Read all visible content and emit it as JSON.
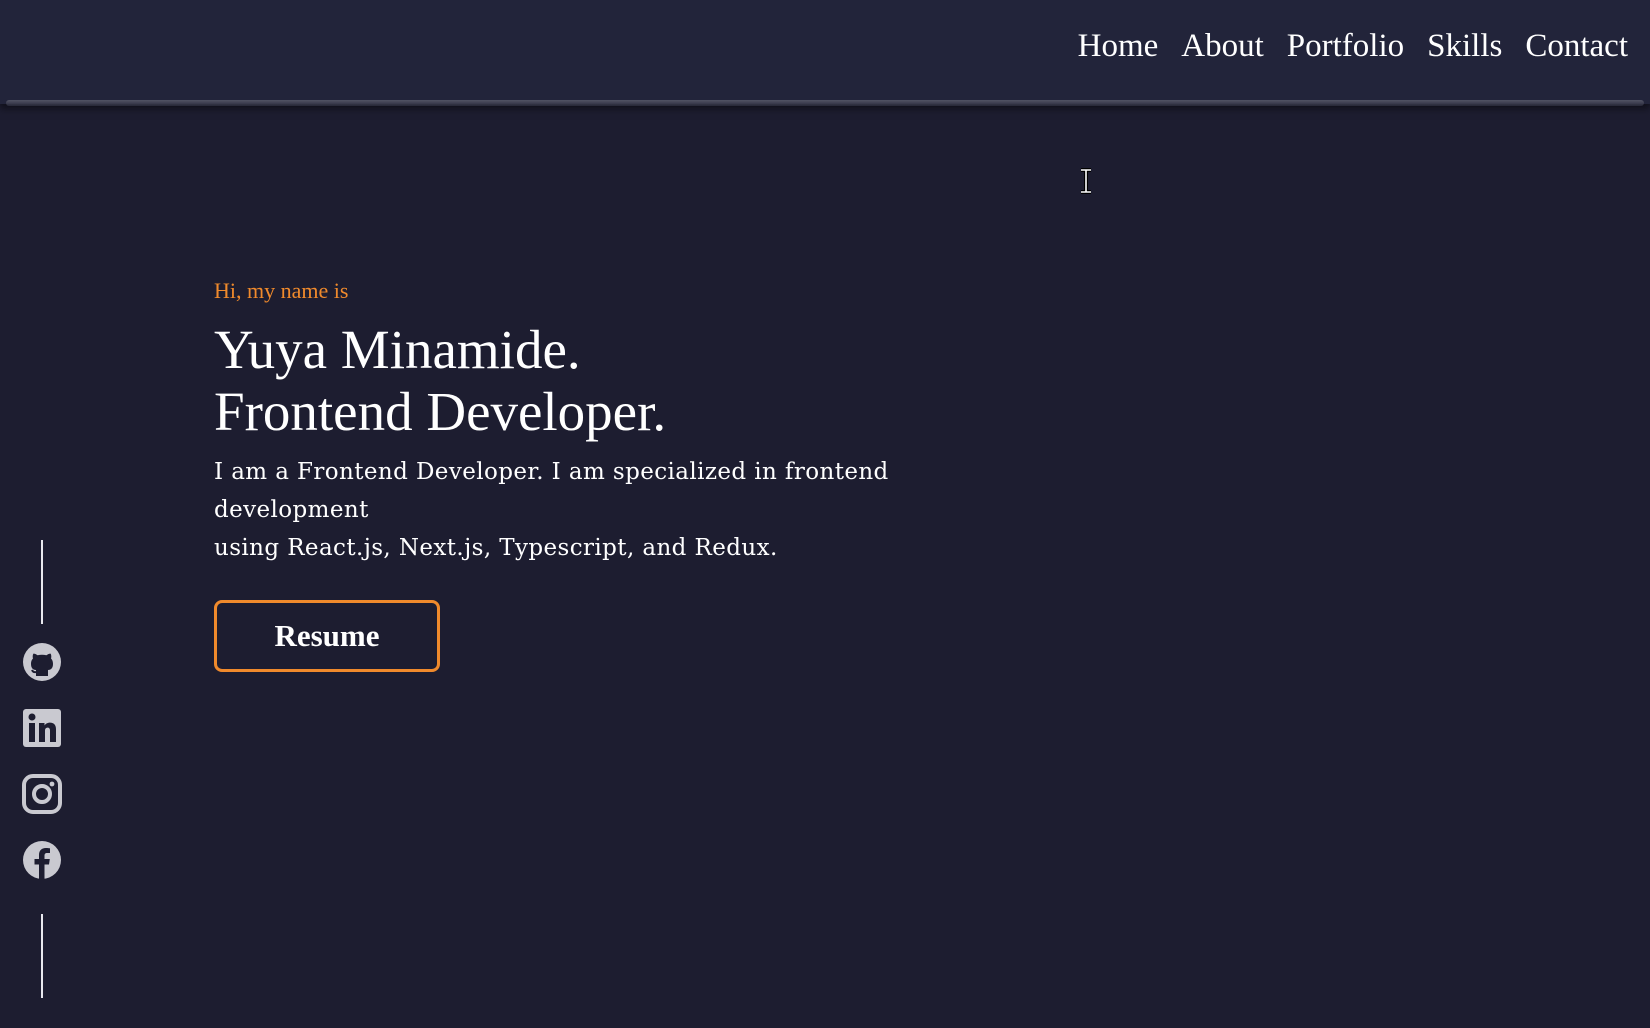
{
  "nav": {
    "links": [
      "Home",
      "About",
      "Portfolio",
      "Skills",
      "Contact"
    ]
  },
  "hero": {
    "greeting": "Hi, my name is",
    "name": "Yuya Minamide.",
    "title": "Frontend Developer.",
    "intro_line1": "I am a Frontend Developer. I am specialized in frontend development",
    "intro_line2": "using React.js, Next.js, Typescript, and Redux.",
    "resume_label": "Resume"
  },
  "social": {
    "icons": [
      "github-icon",
      "linkedin-icon",
      "instagram-icon",
      "facebook-icon"
    ]
  },
  "colors": {
    "background": "#1d1d30",
    "navbar": "#22243a",
    "accent": "#f08a2c",
    "text": "#ffffff",
    "icon": "#c9c9d0"
  }
}
